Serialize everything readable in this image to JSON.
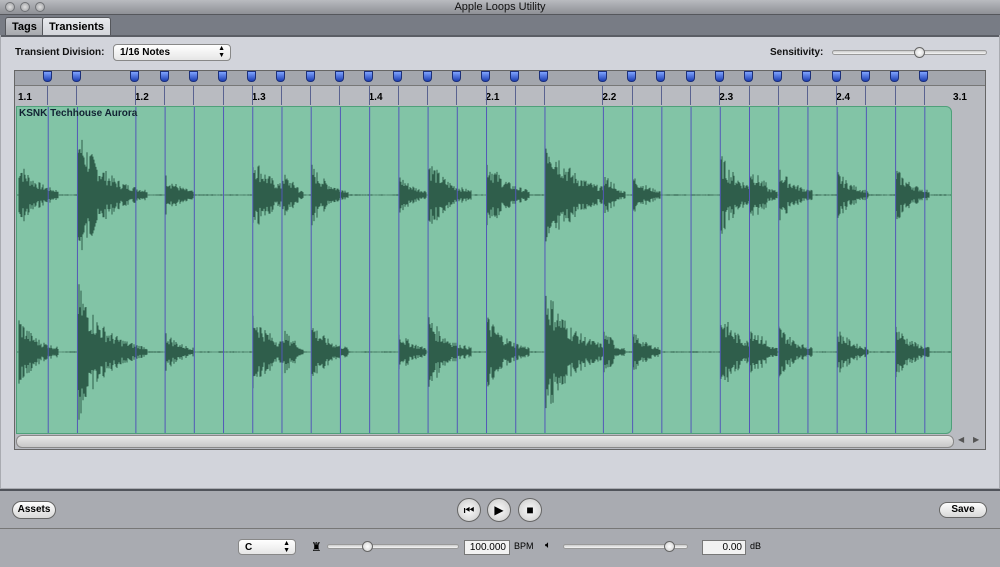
{
  "window": {
    "title": "Apple Loops Utility"
  },
  "tabs": [
    {
      "label": "Tags",
      "active": false
    },
    {
      "label": "Transients",
      "active": true
    }
  ],
  "controls": {
    "transient_division_label": "Transient Division:",
    "transient_division_value": "1/16 Notes",
    "sensitivity_label": "Sensitivity:",
    "sensitivity_value": 0.56
  },
  "ruler": {
    "labels": [
      "1.1",
      "1.2",
      "1.3",
      "1.4",
      "2.1",
      "2.2",
      "2.3",
      "2.4",
      "3.1"
    ]
  },
  "transient_markers_sixteenths": [
    1,
    2,
    4,
    5,
    6,
    7,
    8,
    9,
    10,
    11,
    12,
    13,
    14,
    15,
    16,
    17,
    18,
    20,
    21,
    22,
    23,
    24,
    25,
    26,
    27,
    28,
    29,
    30,
    31
  ],
  "region": {
    "name": "KSNK Techhouse Aurora",
    "color": "#82c4a6",
    "wave_color": "#2f5e4b"
  },
  "bottom": {
    "assets_label": "Assets",
    "save_label": "Save",
    "key_value": "C",
    "tempo_value": "100.000",
    "tempo_unit": "BPM",
    "tempo_slider": 0.3,
    "volume_value": "0.00",
    "volume_unit": "dB",
    "volume_slider": 0.85
  },
  "icons": {
    "rewind": "rewind-to-start-icon",
    "play": "play-icon",
    "stop": "stop-icon",
    "metronome": "metronome-icon",
    "speaker": "speaker-icon"
  }
}
